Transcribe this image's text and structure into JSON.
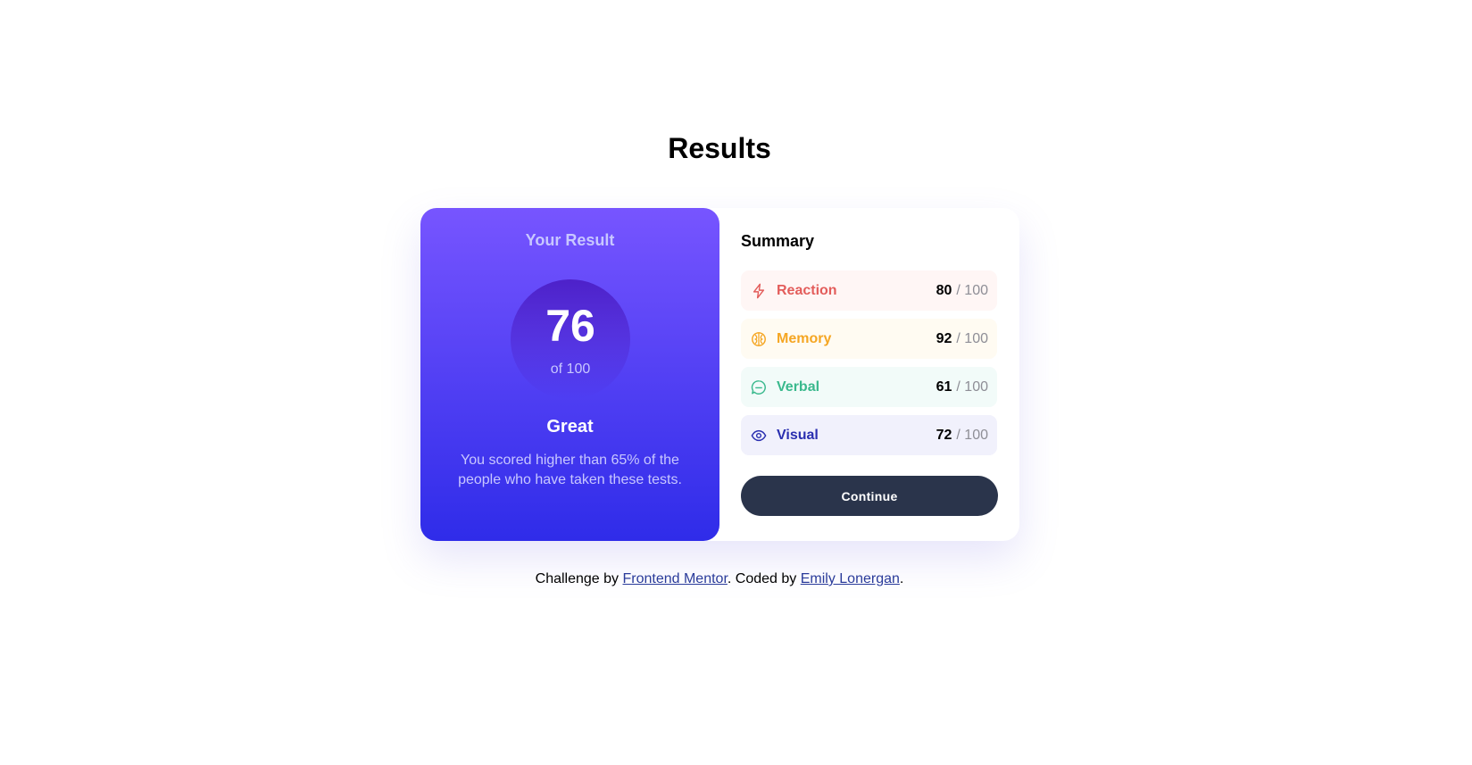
{
  "page": {
    "title": "Results",
    "attribution": {
      "prefix": "Challenge by ",
      "link1": "Frontend Mentor",
      "middle": ". Coded by ",
      "link2": "Emily Lonergan",
      "suffix": "."
    }
  },
  "result": {
    "heading": "Your Result",
    "score": "76",
    "score_max": "of 100",
    "rating": "Great",
    "description": "You scored higher than 65% of the people who have taken these tests."
  },
  "summary": {
    "heading": "Summary",
    "items": [
      {
        "label": "Reaction",
        "score": "80",
        "max": "/ 100",
        "icon": "lightning-icon",
        "color": "#e35d5b"
      },
      {
        "label": "Memory",
        "score": "92",
        "max": "/ 100",
        "icon": "brain-icon",
        "color": "#f5a623"
      },
      {
        "label": "Verbal",
        "score": "61",
        "max": "/ 100",
        "icon": "chat-bubble-icon",
        "color": "#3ab98d"
      },
      {
        "label": "Visual",
        "score": "72",
        "max": "/ 100",
        "icon": "eye-icon",
        "color": "#2a2fb0"
      }
    ],
    "button_label": "Continue"
  },
  "colors": {
    "gradient_top": "#7755ff",
    "gradient_bottom": "#2f2ce9",
    "button": "#2a344b"
  }
}
